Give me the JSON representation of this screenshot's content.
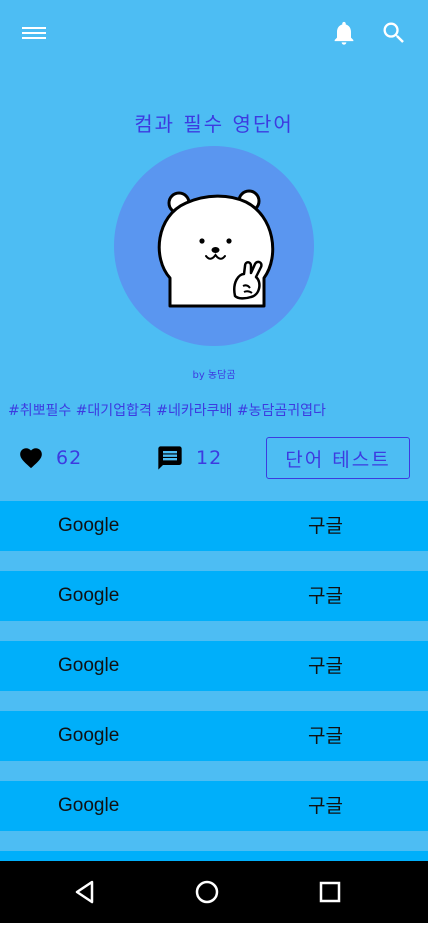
{
  "header": {
    "menu_icon": "menu-icon",
    "bell_icon": "bell-icon",
    "search_icon": "search-icon"
  },
  "wordbook": {
    "title": "컴과 필수 영단어",
    "author": "by 농담곰",
    "tags": "#취뽀필수 #대기업합격 #네카라쿠배 #농담곰귀엽다",
    "likes": "62",
    "comments": "12",
    "test_button": "단어 테스트"
  },
  "words": [
    {
      "en": "Google",
      "ko": "구글"
    },
    {
      "en": "Google",
      "ko": "구글"
    },
    {
      "en": "Google",
      "ko": "구글"
    },
    {
      "en": "Google",
      "ko": "구글"
    },
    {
      "en": "Google",
      "ko": "구글"
    }
  ],
  "colors": {
    "background": "#4dbdf3",
    "accent": "#3d3be0",
    "row": "#00affa",
    "avatar_circle": "#5a96f0"
  },
  "navigation": {
    "back_icon": "back-triangle-icon",
    "home_icon": "home-circle-icon",
    "recent_icon": "recent-square-icon"
  }
}
